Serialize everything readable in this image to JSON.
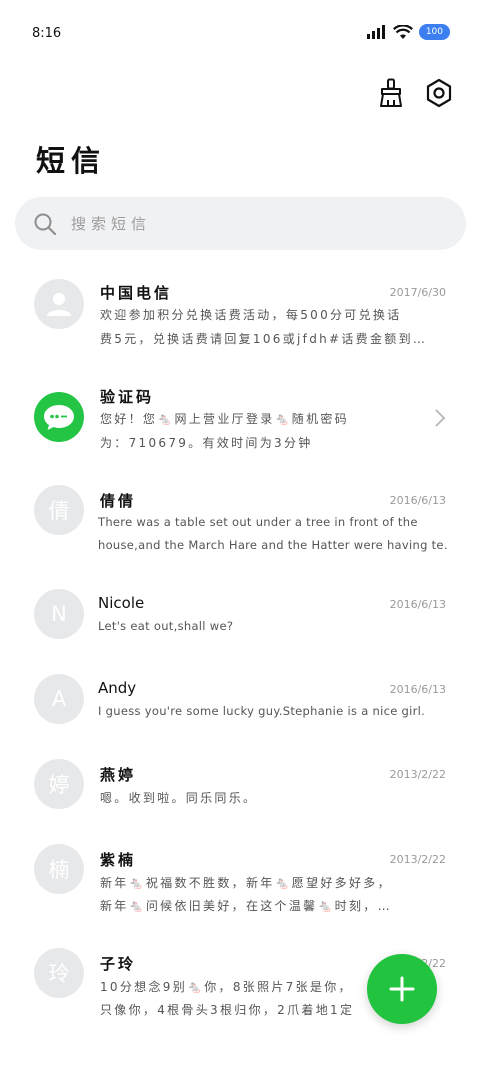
{
  "status_bar": {
    "time": "8:16",
    "battery": "100"
  },
  "header": {
    "title": "短信"
  },
  "search": {
    "placeholder": "搜索短信"
  },
  "messages": [
    {
      "name": "中国电信",
      "date": "2017/6/30",
      "avatar_text": "",
      "avatar_icon": "person-icon",
      "line1": "欢迎参加积分兑换话费活动，每500分可兑换话",
      "line2": "费5元，兑换话费请回复106或jfdh#话费金额到…"
    },
    {
      "name": "验证码",
      "date": "",
      "avatar_text": "",
      "avatar_icon": "chat-bubble-icon",
      "line1": "您好！您🐁网上营业厅登录🐁随机密码",
      "line2": "为：710679。有效时间为3分钟"
    },
    {
      "name": "倩倩",
      "date": "2016/6/13",
      "avatar_text": "倩",
      "line1": "There was a table set out under a tree in front of the",
      "line2": "house,and the March Hare and the Hatter were having te…"
    },
    {
      "name": "Nicole",
      "date": "2016/6/13",
      "avatar_text": "N",
      "line1": "Let's eat out,shall we?",
      "line2": ""
    },
    {
      "name": "Andy",
      "date": "2016/6/13",
      "avatar_text": "A",
      "line1": "I guess you're some lucky guy.Stephanie is a nice girl.",
      "line2": ""
    },
    {
      "name": "燕婷",
      "date": "2013/2/22",
      "avatar_text": "婷",
      "line1": "嗯。收到啦。同乐同乐。",
      "line2": ""
    },
    {
      "name": "紫楠",
      "date": "2013/2/22",
      "avatar_text": "楠",
      "line1": "新年🐁祝福数不胜数，新年🐁愿望好多好多，",
      "line2": "新年🐁问候依旧美好，在这个温馨🐁时刻，…"
    },
    {
      "name": "子玲",
      "date": "2013/2/22",
      "avatar_text": "玲",
      "line1": "10分想念9别🐁你，8张照片7张是你，",
      "line2": "只像你，4根骨头3根归你，2爪着地1定"
    }
  ],
  "colors": {
    "accent": "#22c43f",
    "avatar_grey": "#e7e8ea",
    "search_bg": "#f0f1f3",
    "battery": "#3b7ff0"
  }
}
